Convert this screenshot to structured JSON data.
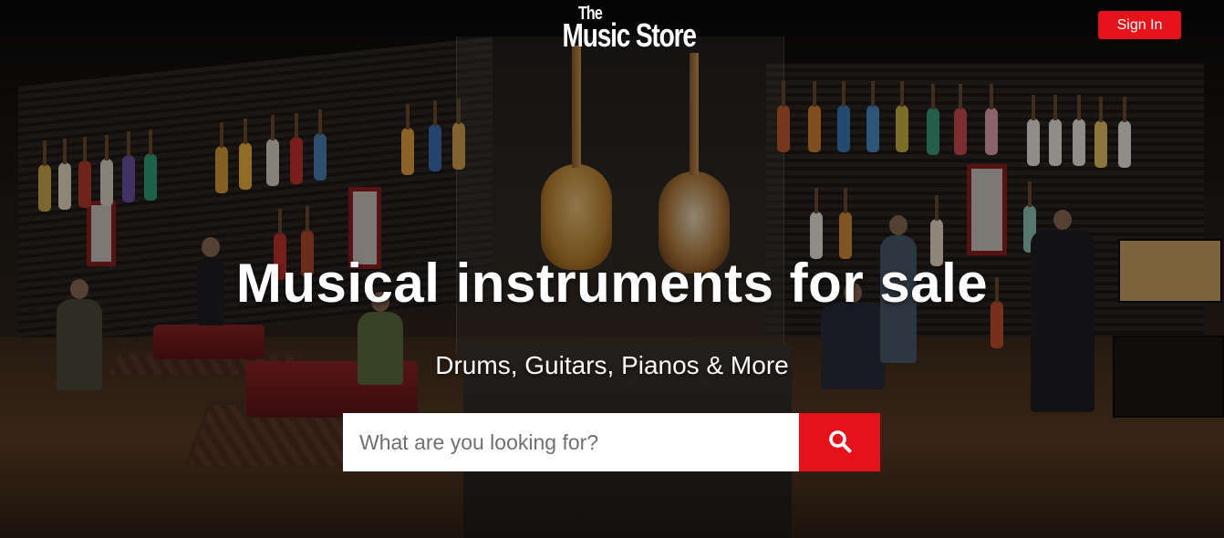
{
  "header": {
    "logo_top": "The",
    "logo_main": "Music Store",
    "signin_label": "Sign In"
  },
  "hero": {
    "headline": "Musical instruments for sale",
    "subheadline": "Drums, Guitars, Pianos & More"
  },
  "search": {
    "placeholder": "What are you looking for?",
    "value": "",
    "button_icon": "search-icon"
  },
  "colors": {
    "accent": "#e5121a",
    "text": "#ffffff"
  }
}
